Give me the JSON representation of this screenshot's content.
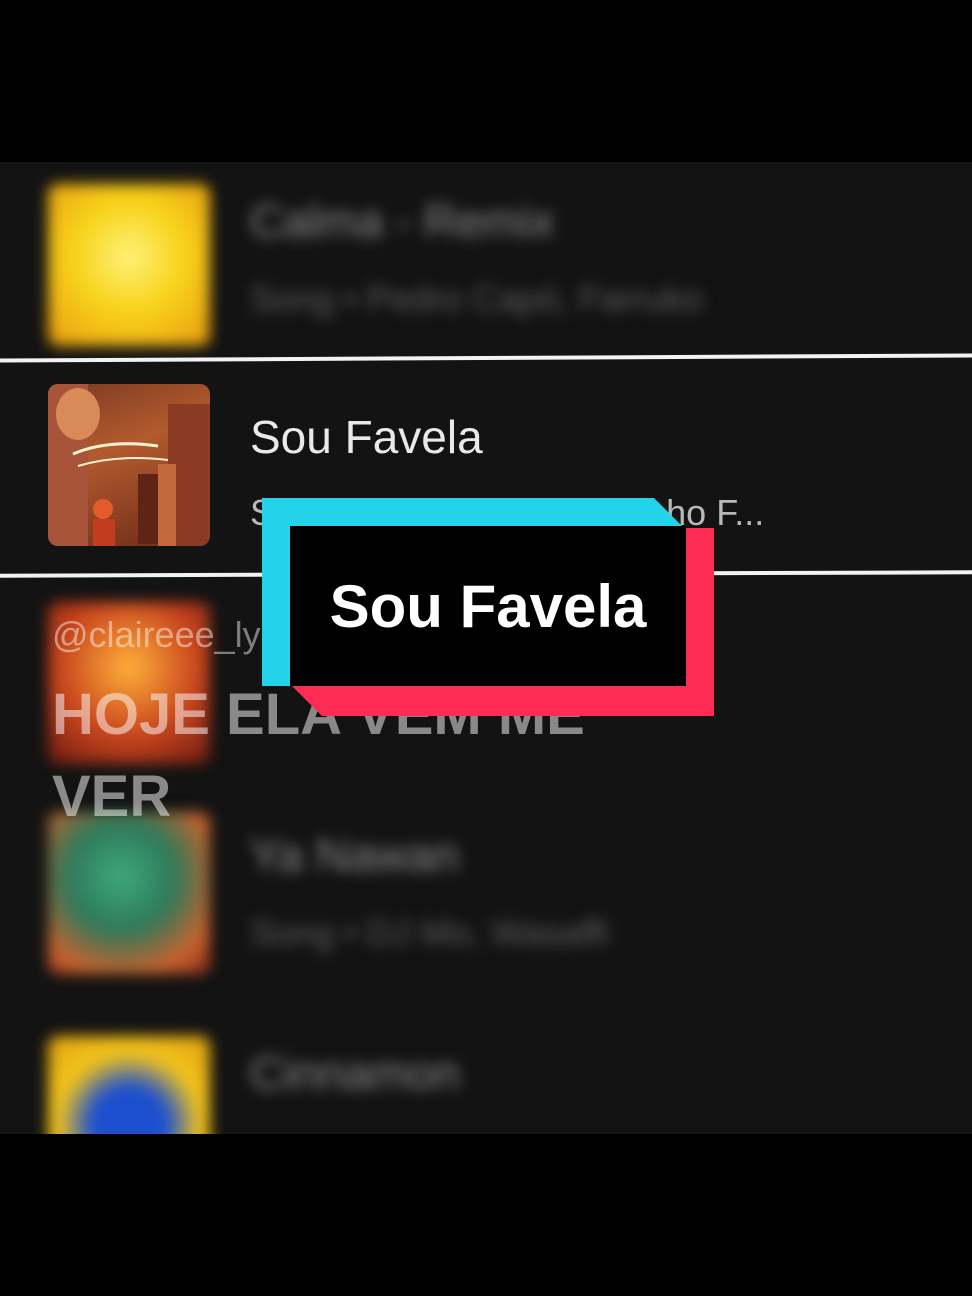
{
  "playlist": {
    "items": [
      {
        "title": "Calma - Remix",
        "subtitle": "Song • Pedro Capó, Farruko",
        "blurred": true
      },
      {
        "title": "Sou Favela",
        "subtitle": "Song • MC Bruninho, Vitinho F...",
        "blurred": false,
        "selected": true
      },
      {
        "title": "",
        "subtitle": "",
        "blurred": true
      },
      {
        "title": "Ya Nawan",
        "subtitle": "Song • DJ Mo, Wasaffi",
        "blurred": true
      },
      {
        "title": "Cinnamon",
        "subtitle": "",
        "blurred": true
      }
    ]
  },
  "overlay": {
    "username": "@claireee_ly",
    "caption": "HOJE ELA VEM ME VER",
    "tag_text": "Sou Favela"
  },
  "colors": {
    "background": "#000000",
    "list_bg": "#131313",
    "accent_cyan": "#22d3ea",
    "accent_red": "#fe2c55",
    "divider": "#f2f2f2"
  }
}
